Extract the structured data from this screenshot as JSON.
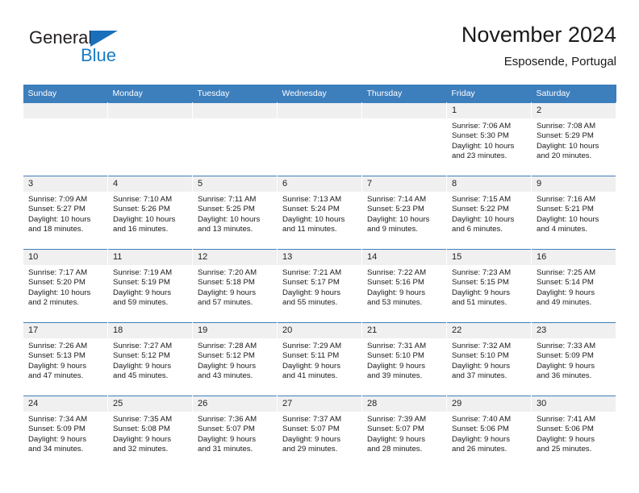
{
  "brand": {
    "name_primary": "General",
    "name_secondary": "Blue",
    "primary_color": "#231f20",
    "secondary_color": "#1a7ac4",
    "triangle_color": "#1a6fba"
  },
  "header": {
    "title": "November 2024",
    "subtitle": "Esposende, Portugal"
  },
  "calendar": {
    "header_bg": "#3d7ebd",
    "header_text_color": "#ffffff",
    "daynum_bg": "#f0f0f0",
    "weekday_headers": [
      "Sunday",
      "Monday",
      "Tuesday",
      "Wednesday",
      "Thursday",
      "Friday",
      "Saturday"
    ],
    "weeks": [
      [
        {
          "day": "",
          "sunrise": "",
          "sunset": "",
          "daylight_a": "",
          "daylight_b": ""
        },
        {
          "day": "",
          "sunrise": "",
          "sunset": "",
          "daylight_a": "",
          "daylight_b": ""
        },
        {
          "day": "",
          "sunrise": "",
          "sunset": "",
          "daylight_a": "",
          "daylight_b": ""
        },
        {
          "day": "",
          "sunrise": "",
          "sunset": "",
          "daylight_a": "",
          "daylight_b": ""
        },
        {
          "day": "",
          "sunrise": "",
          "sunset": "",
          "daylight_a": "",
          "daylight_b": ""
        },
        {
          "day": "1",
          "sunrise": "Sunrise: 7:06 AM",
          "sunset": "Sunset: 5:30 PM",
          "daylight_a": "Daylight: 10 hours",
          "daylight_b": "and 23 minutes."
        },
        {
          "day": "2",
          "sunrise": "Sunrise: 7:08 AM",
          "sunset": "Sunset: 5:29 PM",
          "daylight_a": "Daylight: 10 hours",
          "daylight_b": "and 20 minutes."
        }
      ],
      [
        {
          "day": "3",
          "sunrise": "Sunrise: 7:09 AM",
          "sunset": "Sunset: 5:27 PM",
          "daylight_a": "Daylight: 10 hours",
          "daylight_b": "and 18 minutes."
        },
        {
          "day": "4",
          "sunrise": "Sunrise: 7:10 AM",
          "sunset": "Sunset: 5:26 PM",
          "daylight_a": "Daylight: 10 hours",
          "daylight_b": "and 16 minutes."
        },
        {
          "day": "5",
          "sunrise": "Sunrise: 7:11 AM",
          "sunset": "Sunset: 5:25 PM",
          "daylight_a": "Daylight: 10 hours",
          "daylight_b": "and 13 minutes."
        },
        {
          "day": "6",
          "sunrise": "Sunrise: 7:13 AM",
          "sunset": "Sunset: 5:24 PM",
          "daylight_a": "Daylight: 10 hours",
          "daylight_b": "and 11 minutes."
        },
        {
          "day": "7",
          "sunrise": "Sunrise: 7:14 AM",
          "sunset": "Sunset: 5:23 PM",
          "daylight_a": "Daylight: 10 hours",
          "daylight_b": "and 9 minutes."
        },
        {
          "day": "8",
          "sunrise": "Sunrise: 7:15 AM",
          "sunset": "Sunset: 5:22 PM",
          "daylight_a": "Daylight: 10 hours",
          "daylight_b": "and 6 minutes."
        },
        {
          "day": "9",
          "sunrise": "Sunrise: 7:16 AM",
          "sunset": "Sunset: 5:21 PM",
          "daylight_a": "Daylight: 10 hours",
          "daylight_b": "and 4 minutes."
        }
      ],
      [
        {
          "day": "10",
          "sunrise": "Sunrise: 7:17 AM",
          "sunset": "Sunset: 5:20 PM",
          "daylight_a": "Daylight: 10 hours",
          "daylight_b": "and 2 minutes."
        },
        {
          "day": "11",
          "sunrise": "Sunrise: 7:19 AM",
          "sunset": "Sunset: 5:19 PM",
          "daylight_a": "Daylight: 9 hours",
          "daylight_b": "and 59 minutes."
        },
        {
          "day": "12",
          "sunrise": "Sunrise: 7:20 AM",
          "sunset": "Sunset: 5:18 PM",
          "daylight_a": "Daylight: 9 hours",
          "daylight_b": "and 57 minutes."
        },
        {
          "day": "13",
          "sunrise": "Sunrise: 7:21 AM",
          "sunset": "Sunset: 5:17 PM",
          "daylight_a": "Daylight: 9 hours",
          "daylight_b": "and 55 minutes."
        },
        {
          "day": "14",
          "sunrise": "Sunrise: 7:22 AM",
          "sunset": "Sunset: 5:16 PM",
          "daylight_a": "Daylight: 9 hours",
          "daylight_b": "and 53 minutes."
        },
        {
          "day": "15",
          "sunrise": "Sunrise: 7:23 AM",
          "sunset": "Sunset: 5:15 PM",
          "daylight_a": "Daylight: 9 hours",
          "daylight_b": "and 51 minutes."
        },
        {
          "day": "16",
          "sunrise": "Sunrise: 7:25 AM",
          "sunset": "Sunset: 5:14 PM",
          "daylight_a": "Daylight: 9 hours",
          "daylight_b": "and 49 minutes."
        }
      ],
      [
        {
          "day": "17",
          "sunrise": "Sunrise: 7:26 AM",
          "sunset": "Sunset: 5:13 PM",
          "daylight_a": "Daylight: 9 hours",
          "daylight_b": "and 47 minutes."
        },
        {
          "day": "18",
          "sunrise": "Sunrise: 7:27 AM",
          "sunset": "Sunset: 5:12 PM",
          "daylight_a": "Daylight: 9 hours",
          "daylight_b": "and 45 minutes."
        },
        {
          "day": "19",
          "sunrise": "Sunrise: 7:28 AM",
          "sunset": "Sunset: 5:12 PM",
          "daylight_a": "Daylight: 9 hours",
          "daylight_b": "and 43 minutes."
        },
        {
          "day": "20",
          "sunrise": "Sunrise: 7:29 AM",
          "sunset": "Sunset: 5:11 PM",
          "daylight_a": "Daylight: 9 hours",
          "daylight_b": "and 41 minutes."
        },
        {
          "day": "21",
          "sunrise": "Sunrise: 7:31 AM",
          "sunset": "Sunset: 5:10 PM",
          "daylight_a": "Daylight: 9 hours",
          "daylight_b": "and 39 minutes."
        },
        {
          "day": "22",
          "sunrise": "Sunrise: 7:32 AM",
          "sunset": "Sunset: 5:10 PM",
          "daylight_a": "Daylight: 9 hours",
          "daylight_b": "and 37 minutes."
        },
        {
          "day": "23",
          "sunrise": "Sunrise: 7:33 AM",
          "sunset": "Sunset: 5:09 PM",
          "daylight_a": "Daylight: 9 hours",
          "daylight_b": "and 36 minutes."
        }
      ],
      [
        {
          "day": "24",
          "sunrise": "Sunrise: 7:34 AM",
          "sunset": "Sunset: 5:09 PM",
          "daylight_a": "Daylight: 9 hours",
          "daylight_b": "and 34 minutes."
        },
        {
          "day": "25",
          "sunrise": "Sunrise: 7:35 AM",
          "sunset": "Sunset: 5:08 PM",
          "daylight_a": "Daylight: 9 hours",
          "daylight_b": "and 32 minutes."
        },
        {
          "day": "26",
          "sunrise": "Sunrise: 7:36 AM",
          "sunset": "Sunset: 5:07 PM",
          "daylight_a": "Daylight: 9 hours",
          "daylight_b": "and 31 minutes."
        },
        {
          "day": "27",
          "sunrise": "Sunrise: 7:37 AM",
          "sunset": "Sunset: 5:07 PM",
          "daylight_a": "Daylight: 9 hours",
          "daylight_b": "and 29 minutes."
        },
        {
          "day": "28",
          "sunrise": "Sunrise: 7:39 AM",
          "sunset": "Sunset: 5:07 PM",
          "daylight_a": "Daylight: 9 hours",
          "daylight_b": "and 28 minutes."
        },
        {
          "day": "29",
          "sunrise": "Sunrise: 7:40 AM",
          "sunset": "Sunset: 5:06 PM",
          "daylight_a": "Daylight: 9 hours",
          "daylight_b": "and 26 minutes."
        },
        {
          "day": "30",
          "sunrise": "Sunrise: 7:41 AM",
          "sunset": "Sunset: 5:06 PM",
          "daylight_a": "Daylight: 9 hours",
          "daylight_b": "and 25 minutes."
        }
      ]
    ]
  }
}
